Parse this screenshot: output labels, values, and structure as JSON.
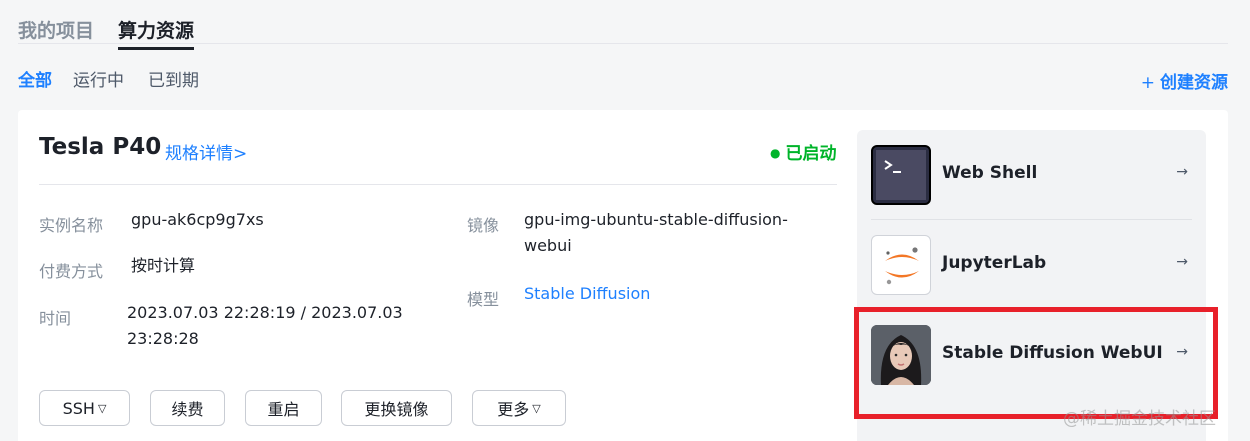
{
  "top_tabs": {
    "my_projects": "我的项目",
    "compute": "算力资源"
  },
  "filters": {
    "all": "全部",
    "running": "运行中",
    "expired": "已到期"
  },
  "create_button": {
    "icon": "+",
    "label": "创建资源"
  },
  "instance": {
    "gpu_name": "Tesla P40",
    "spec_link": "规格详情>",
    "status": "已启动",
    "status_color": "#00b42a",
    "fields": {
      "name_label": "实例名称",
      "name_value": "gpu-ak6cp9g7xs",
      "billing_label": "付费方式",
      "billing_value": "按时计算",
      "time_label": "时间",
      "time_value_line1": "2023.07.03 22:28:19 / 2023.07.03",
      "time_value_line2": "23:28:28",
      "image_label": "镜像",
      "image_value_line1": "gpu-img-ubuntu-stable-diffusion-",
      "image_value_line2": "webui",
      "model_label": "模型",
      "model_value": "Stable Diffusion"
    },
    "buttons": {
      "ssh": "SSH",
      "renew": "续费",
      "restart": "重启",
      "change_image": "更换镜像",
      "more": "更多"
    }
  },
  "apps": [
    {
      "name": "Web Shell",
      "icon": "terminal-icon",
      "arrow": "→"
    },
    {
      "name": "JupyterLab",
      "icon": "jupyter-icon",
      "arrow": "→"
    },
    {
      "name": "Stable Diffusion WebUI",
      "icon": "avatar-portrait-icon",
      "arrow": "→"
    }
  ],
  "accent_color": "#1e80ff",
  "highlight_color": "#e8202a",
  "watermark": "@稀土掘金技术社区"
}
